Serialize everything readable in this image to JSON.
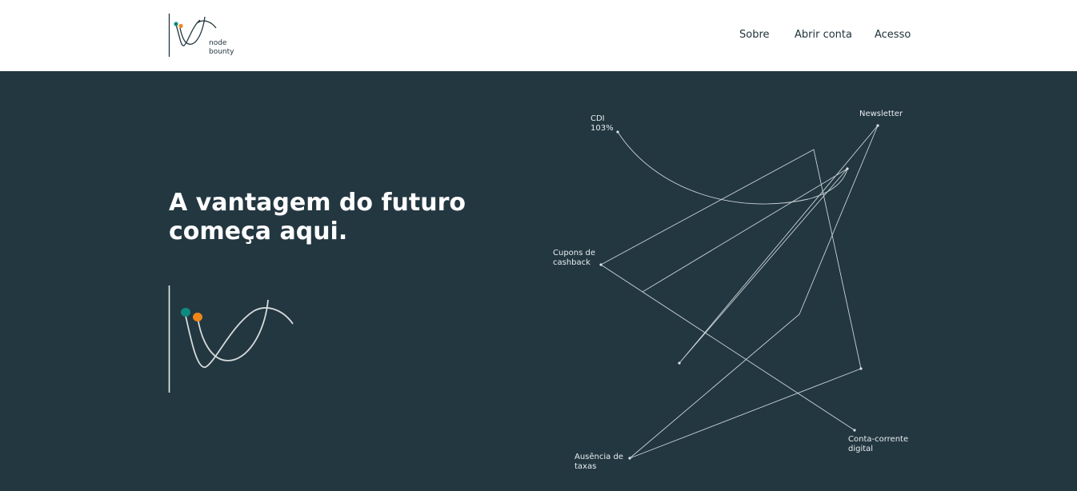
{
  "header": {
    "logo": {
      "line1": "node",
      "line2": "bounty",
      "colors": {
        "teal": "#0e8a80",
        "orange": "#f08519",
        "stroke": "#243740"
      }
    },
    "nav": [
      {
        "label": "Sobre"
      },
      {
        "label": "Abrir conta"
      },
      {
        "label": "Acesso"
      }
    ]
  },
  "hero": {
    "background": "#233741",
    "headline_line1": "A vantagem do futuro",
    "headline_line2": "começa aqui.",
    "graph_labels": {
      "cdi_line1": "CDI",
      "cdi_line2": "103%",
      "newsletter": "Newsletter",
      "cashback_line1": "Cupons de",
      "cashback_line2": "cashback",
      "taxas_line1": "Ausência de",
      "taxas_line2": "taxas",
      "conta_line1": "Conta-corrente",
      "conta_line2": "digital"
    }
  }
}
